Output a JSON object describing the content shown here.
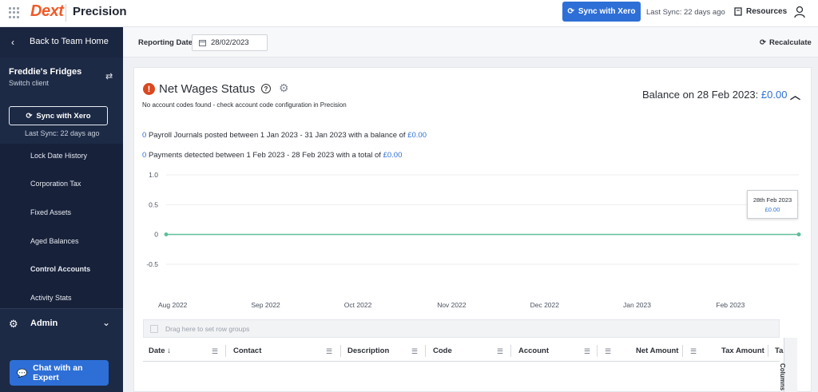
{
  "topbar": {
    "brand": "Dext",
    "product": "Precision",
    "sync_button": "Sync with Xero",
    "last_sync": "Last Sync: 22 days ago",
    "resources": "Resources"
  },
  "sidebar": {
    "back": "Back to Team Home",
    "client_name": "Freddie's Fridges",
    "switch_client": "Switch client",
    "sync_button": "Sync with Xero",
    "last_sync": "Last Sync: 22 days ago",
    "menu": [
      {
        "label": "Lock Date History"
      },
      {
        "label": "Corporation Tax"
      },
      {
        "label": "Fixed Assets"
      },
      {
        "label": "Aged Balances"
      },
      {
        "label": "Control Accounts"
      },
      {
        "label": "Activity Stats"
      }
    ],
    "admin": "Admin",
    "chat": "Chat with an Expert"
  },
  "subbar": {
    "reporting_label": "Reporting Date:",
    "reporting_date": "28/02/2023",
    "recalculate": "Recalculate"
  },
  "card": {
    "title": "Net Wages Status",
    "warning": "No account codes found - check account code configuration in Precision",
    "balance_label": "Balance on 28 Feb 2023:",
    "balance_value": "£0.00",
    "journals_count": "0",
    "journals_text": "Payroll Journals posted between 1 Jan 2023 - 31 Jan 2023 with a balance of",
    "journals_value": "£0.00",
    "payments_count": "0",
    "payments_text": "Payments detected between 1 Feb 2023 - 28 Feb 2023 with a total of",
    "payments_value": "£0.00"
  },
  "tooltip": {
    "date": "28th Feb 2023",
    "value": "£0.00"
  },
  "chart_data": {
    "type": "line",
    "categories": [
      "Aug 2022",
      "Sep 2022",
      "Oct 2022",
      "Nov 2022",
      "Dec 2022",
      "Jan 2023",
      "Feb 2023"
    ],
    "series": [
      {
        "values": [
          0,
          0,
          0,
          0,
          0,
          0,
          0
        ]
      }
    ],
    "yticks": [
      "1.0",
      "0.5",
      "0",
      "-0.5"
    ],
    "ylim": [
      -0.5,
      1.0
    ],
    "grid": true,
    "line_color": "#5fbf9a"
  },
  "grid": {
    "row_group_hint": "Drag here to set row groups",
    "columns": [
      "Date",
      "Contact",
      "Description",
      "Code",
      "Account",
      "Net Amount",
      "Tax Amount",
      "Ta"
    ],
    "columns_panel": "Columns"
  }
}
